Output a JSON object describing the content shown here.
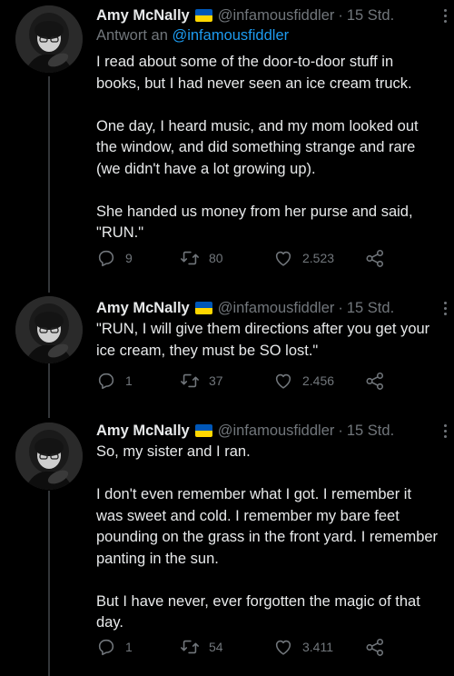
{
  "colors": {
    "background": "#000000",
    "text_primary": "#e7e9ea",
    "text_secondary": "#71767b",
    "link": "#1d9bf0",
    "thread_line": "#333639",
    "flag_blue": "#0057b7",
    "flag_yellow": "#ffd700"
  },
  "tweets": [
    {
      "display_name": "Amy McNally",
      "flag_icon": "ukraine-flag-icon",
      "handle": "@infamousfiddler",
      "separator": "·",
      "time": "15 Std.",
      "reply_prefix": "Antwort an",
      "reply_handle": "@infamousfiddler",
      "text": "I read about some of the door-to-door stuff in books, but I had never seen an ice cream truck.\n\nOne day, I heard music, and my mom looked out the window, and did something strange and rare (we didn't have a lot growing up).\n\nShe handed us money from her purse and said, \"RUN.\"",
      "replies": "9",
      "retweets": "80",
      "likes": "2.523"
    },
    {
      "display_name": "Amy McNally",
      "flag_icon": "ukraine-flag-icon",
      "handle": "@infamousfiddler",
      "separator": "·",
      "time": "15 Std.",
      "text": "\"RUN, I will give them directions after you get your ice cream, they must be SO lost.\"",
      "replies": "1",
      "retweets": "37",
      "likes": "2.456"
    },
    {
      "display_name": "Amy McNally",
      "flag_icon": "ukraine-flag-icon",
      "handle": "@infamousfiddler",
      "separator": "·",
      "time": "15 Std.",
      "text": "So, my sister and I ran.\n\nI don't even remember what I got.  I remember it was sweet and cold.  I remember my bare feet pounding on the grass in the front yard.  I remember panting in the sun.\n\nBut I have never, ever forgotten the magic of that day.",
      "replies": "1",
      "retweets": "54",
      "likes": "3.411"
    }
  ]
}
